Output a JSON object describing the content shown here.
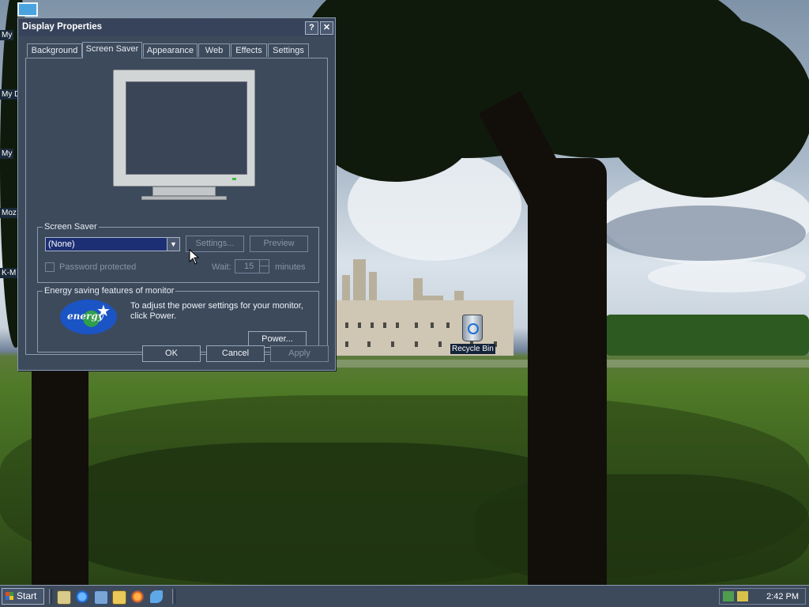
{
  "desktop": {
    "icons": [
      {
        "label": "My"
      },
      {
        "label": "My D"
      },
      {
        "label": "My"
      },
      {
        "label": "Moz"
      },
      {
        "label": "K-M"
      }
    ],
    "recycle_bin_label": "Recycle Bin"
  },
  "dialog": {
    "title": "Display Properties",
    "help_label": "?",
    "close_label": "✕",
    "tabs": [
      {
        "label": "Background"
      },
      {
        "label": "Screen Saver"
      },
      {
        "label": "Appearance"
      },
      {
        "label": "Web"
      },
      {
        "label": "Effects"
      },
      {
        "label": "Settings"
      }
    ],
    "active_tab": "Screen Saver",
    "screen_saver": {
      "group_label": "Screen Saver",
      "selected": "(None)",
      "settings_label": "Settings...",
      "preview_label": "Preview",
      "password_label": "Password protected",
      "wait_label": "Wait:",
      "wait_value": "15",
      "minutes_label": "minutes"
    },
    "energy": {
      "group_label": "Energy saving features of monitor",
      "description": "To adjust the power settings for your monitor, click Power.",
      "logo_text": "energy",
      "power_label": "Power..."
    },
    "ok_label": "OK",
    "cancel_label": "Cancel",
    "apply_label": "Apply"
  },
  "taskbar": {
    "start_label": "Start",
    "quick_launch": [
      "show-desktop-icon",
      "internet-explorer-icon",
      "outlook-express-icon",
      "windows-explorer-icon",
      "firefox-icon",
      "messenger-icon"
    ],
    "clock": "2:42 PM"
  },
  "colors": {
    "dialog_bg": "#3d4a5c",
    "selection": "#1d2f74",
    "border": "#8c9bb0"
  }
}
